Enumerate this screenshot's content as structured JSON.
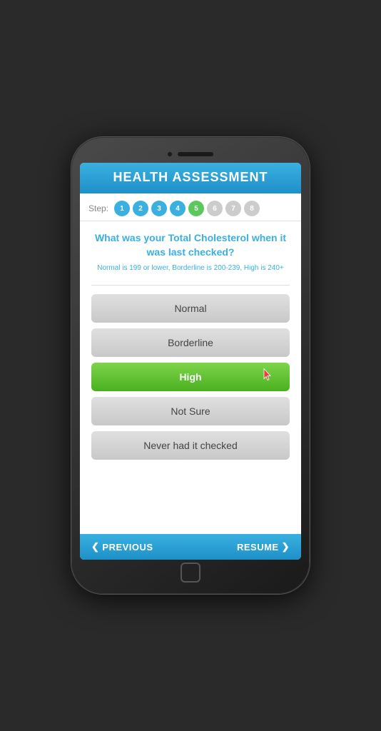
{
  "header": {
    "title": "HEALTH ASSESSMENT"
  },
  "steps": {
    "label": "Step:",
    "items": [
      {
        "number": "1",
        "state": "completed"
      },
      {
        "number": "2",
        "state": "completed"
      },
      {
        "number": "3",
        "state": "completed"
      },
      {
        "number": "4",
        "state": "completed"
      },
      {
        "number": "5",
        "state": "active"
      },
      {
        "number": "6",
        "state": "inactive"
      },
      {
        "number": "7",
        "state": "inactive"
      },
      {
        "number": "8",
        "state": "inactive"
      }
    ]
  },
  "question": {
    "text": "What was your Total Cholesterol when it was last checked?",
    "hint": "Normal is 199 or lower, Borderline is 200-239, High is 240+"
  },
  "options": [
    {
      "label": "Normal",
      "state": "default"
    },
    {
      "label": "Borderline",
      "state": "default"
    },
    {
      "label": "High",
      "state": "selected"
    },
    {
      "label": "Not Sure",
      "state": "default"
    },
    {
      "label": "Never had it checked",
      "state": "default"
    }
  ],
  "footer": {
    "previous_label": "PREVIOUS",
    "resume_label": "RESUME"
  }
}
